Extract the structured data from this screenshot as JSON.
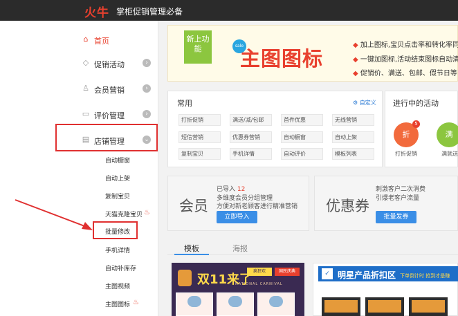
{
  "topbar": {
    "logo": "火牛",
    "slogan": "掌柜促销管理必备"
  },
  "sidebar": {
    "items": [
      {
        "label": "首页",
        "icon": "home-icon",
        "active": true
      },
      {
        "label": "促销活动",
        "icon": "tag-icon"
      },
      {
        "label": "会员营销",
        "icon": "user-icon"
      },
      {
        "label": "评价管理",
        "icon": "comment-icon"
      },
      {
        "label": "店铺管理",
        "icon": "shop-icon",
        "expanded": true
      }
    ],
    "subitems": [
      "自动橱窗",
      "自动上架",
      "复制宝贝",
      "天猫克隆宝贝",
      "批量修改",
      "手机详情",
      "自动补库存",
      "主图视频",
      "主图图标"
    ],
    "arrow_right": "›",
    "arrow_down": "⌄"
  },
  "banner": {
    "badge": "新上功能",
    "sale": "sale",
    "title": "主图图标",
    "bullets": [
      "加上图标,宝贝点击率和转化率同",
      "一键加图标,活动结束图标自动清",
      "促销价、满送、包邮、假节日等"
    ]
  },
  "common": {
    "title": "常用",
    "custom": "自定义",
    "buttons": [
      "打折促销",
      "满送/减/包邮",
      "首件优惠",
      "无线营销",
      "短信营销",
      "优惠券营销",
      "自动橱窗",
      "自动上架",
      "复制宝贝",
      "手机详情",
      "自动评价",
      "模板列表"
    ]
  },
  "activities": {
    "title": "进行中的活动",
    "items": [
      {
        "icon_text": "折",
        "label": "打折促销",
        "count": "5",
        "color": "#f26a3c"
      },
      {
        "icon_text": "满",
        "label": "满就送",
        "color": "#8cc63f"
      }
    ]
  },
  "member": {
    "word": "会员",
    "imported_label": "已导入",
    "imported_count": "12",
    "line2": "多维度会员分组管理",
    "line3": "方便对新老顾客进行精准营销",
    "button": "立即导入"
  },
  "coupon": {
    "word": "优惠券",
    "line1": "刺激客户二次消费",
    "line2": "引爆老客户流量",
    "button": "批量发券"
  },
  "tabs": [
    {
      "label": "模板",
      "active": true
    },
    {
      "label": "海报"
    }
  ],
  "templates": {
    "t1": {
      "word": "双11来了",
      "tag1": "疯狂欢",
      "tag2": "国民庆典",
      "sub": "NATIONAL CARNIVAL"
    },
    "t2": {
      "icon": "✓",
      "title": "明星产品折扣区",
      "sub": "下单倒计时 抢到才是赚"
    }
  },
  "colors": {
    "accent": "#e8402e",
    "blue": "#3a8ee6",
    "topbar": "#2b2b2b"
  }
}
